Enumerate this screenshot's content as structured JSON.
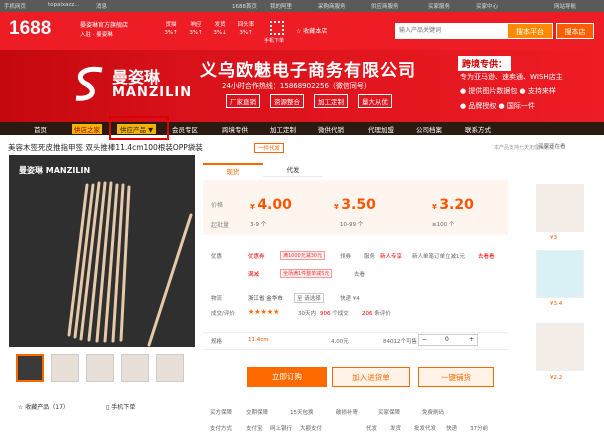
{
  "topbar": {
    "items": [
      "手机网页",
      "topaixazz...",
      "消息",
      "1688首页",
      "我的阿里",
      "采购商服务",
      "供应商服务",
      "买家服务",
      "买家中心",
      "网站导航"
    ]
  },
  "header": {
    "logo": "1688",
    "shop_name": "晏姿琳官方旗舰店",
    "shop_sub": "入驻 · 曼姿琳",
    "stats": [
      {
        "l": "货描",
        "v": "3%↑"
      },
      {
        "l": "响应",
        "v": "3%↑"
      },
      {
        "l": "发货",
        "v": "3%↓"
      },
      {
        "l": "回头率",
        "v": "3%↑"
      }
    ],
    "qr": "手机下单",
    "collect": "收藏本店",
    "search_placeholder": "输入产品关键词",
    "search_all": "搜本平台",
    "search_shop": "搜本店"
  },
  "banner": {
    "brand_cn": "曼姿琳",
    "brand_en": "MANZILIN",
    "company": "义乌欧魅电子商务有限公司",
    "hours": "24小时合作热线：15868902256（微信同号）",
    "tags": [
      "厂家直销",
      "资源整合",
      "加工定制",
      "量大从优"
    ],
    "cross": "跨境专供：",
    "cross_lines": [
      "专为亚马逊、速卖通、WISH店主",
      "● 提供图片数据包   ● 支持来样",
      "● 品牌授权          ● 国际一件"
    ]
  },
  "nav": {
    "items": [
      "首页",
      "供应产品 ▼",
      "会员专区",
      "跨境专供",
      "加工定制",
      "微供代销",
      "代理加盟",
      "公司档案",
      "联系方式"
    ],
    "shop_tag": "供店之家"
  },
  "product": {
    "title": "美容木签死皮推指甲签 双头推棒11.4cm100根装OPP袋装",
    "badge": "一件代发",
    "help": "本产品支持七天无理由退货",
    "img_logo": "曼姿琳 MANZILIN",
    "fav": "收藏产品（17）",
    "phone": "手机下单"
  },
  "tabs": {
    "buy": "现货",
    "dist": "代发"
  },
  "prices": {
    "label_price": "价格",
    "label_qty": "起批量",
    "tiers": [
      {
        "p": "4.00",
        "q": "3-9 个"
      },
      {
        "p": "3.50",
        "q": "10-99 个"
      },
      {
        "p": "3.20",
        "q": "≥100 个"
      }
    ]
  },
  "promo": {
    "label": "优惠",
    "coupon1": "优惠券",
    "coupon1_text": "满1000元减30元",
    "coupon1_sub": "领券",
    "coupon2": "满减",
    "coupon2_text": "全场满1件整单减5元",
    "coupon2_sub": "去看",
    "service": "服务",
    "reg": "新人专享",
    "reg_text": "新人单笔订单立减1元",
    "reg_link": "去看看"
  },
  "ship": {
    "label": "物流",
    "from": "浙江省 金华市",
    "to": "至 请选择",
    "fee": "快递 ¥4",
    "sold_label": "成交/评价",
    "stars": "★★★★★",
    "days": "30天内",
    "sold": "906",
    "sold_unit": "个成交",
    "reviews": "206",
    "review_unit": "条评价"
  },
  "spec": {
    "label": "规格",
    "size": "11.4cm",
    "price": "4.00元",
    "stock": "84012个可售",
    "qty": "0"
  },
  "buttons": {
    "buy": "立即订购",
    "cart": "加入进货单",
    "dropship": "一键铺货"
  },
  "guarantee": {
    "label": "买方保障",
    "items": [
      "交期保障",
      "15天包换",
      "破损补寄",
      "买家保障",
      "免费刷码"
    ],
    "pay_label": "支付方式",
    "pay": [
      "支付宝",
      "网上银行",
      "大额支付"
    ],
    "pay2_label": "代发",
    "pay2": [
      "发货",
      "批发代发",
      "快递",
      "37分前"
    ]
  },
  "side": {
    "title": "买家还在看",
    "prices": [
      "¥3",
      "¥3.4",
      "¥2.2"
    ]
  }
}
